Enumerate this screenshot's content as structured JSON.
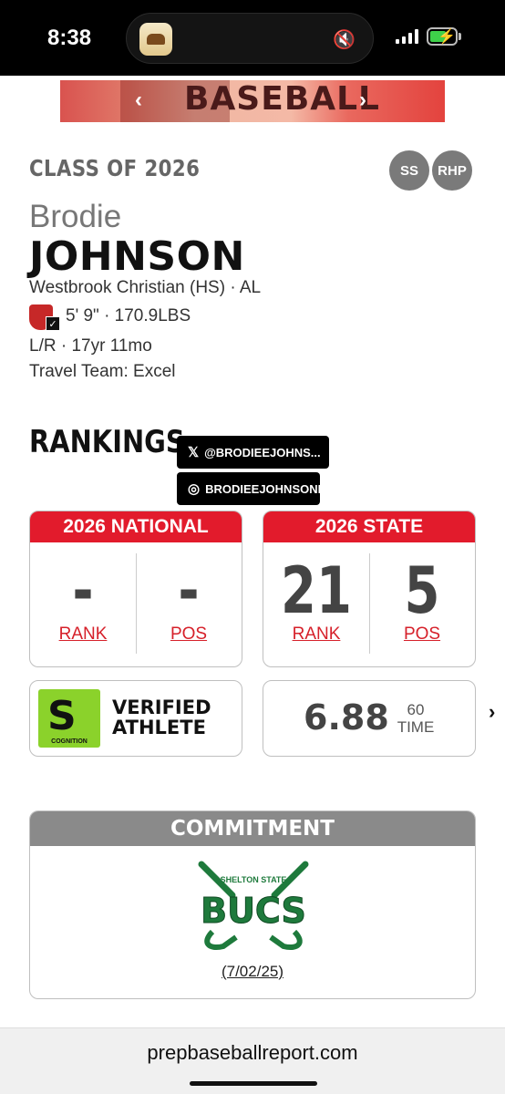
{
  "status_bar": {
    "time": "8:38",
    "signal_bars": 4,
    "battery_charging": true
  },
  "banner": {
    "text": "BASEBALL"
  },
  "player": {
    "class_year": "CLASS OF 2026",
    "positions": [
      "SS",
      "RHP"
    ],
    "first_name": "Brodie",
    "last_name": "JOHNSON",
    "school": "Westbrook Christian (HS) · AL",
    "size": "5' 9\" · 170.9LBS",
    "bats_throws_age": "L/R · 17yr 11mo",
    "travel_team": "Travel Team: Excel"
  },
  "rankings": {
    "title": "RANKINGS",
    "social": {
      "x_handle": "@BRODIEEJOHNS...",
      "instagram_handle": "BRODIEEJOHNSONN"
    },
    "national": {
      "header": "2026 NATIONAL",
      "rank": "-",
      "rank_label": "RANK",
      "pos": "-",
      "pos_label": "POS"
    },
    "state": {
      "header": "2026 STATE",
      "rank": "21",
      "rank_label": "RANK",
      "pos": "5",
      "pos_label": "POS"
    }
  },
  "verified": {
    "line1": "VERIFIED",
    "line2": "ATHLETE",
    "brand": "COGNITION"
  },
  "sixty": {
    "value": "6.88",
    "label_line1": "60",
    "label_line2": "TIME"
  },
  "commitment": {
    "header": "COMMITMENT",
    "logo_top": "SHELTON STATE",
    "logo_main": "BUCS",
    "date": "(7/02/25)"
  },
  "url_bar": {
    "url": "prepbaseballreport.com"
  },
  "colors": {
    "accent_red": "#e21b2c",
    "commit_gray": "#8a8a8a",
    "bucs_green": "#1e7a3c",
    "cognition_green": "#8bd22b"
  }
}
